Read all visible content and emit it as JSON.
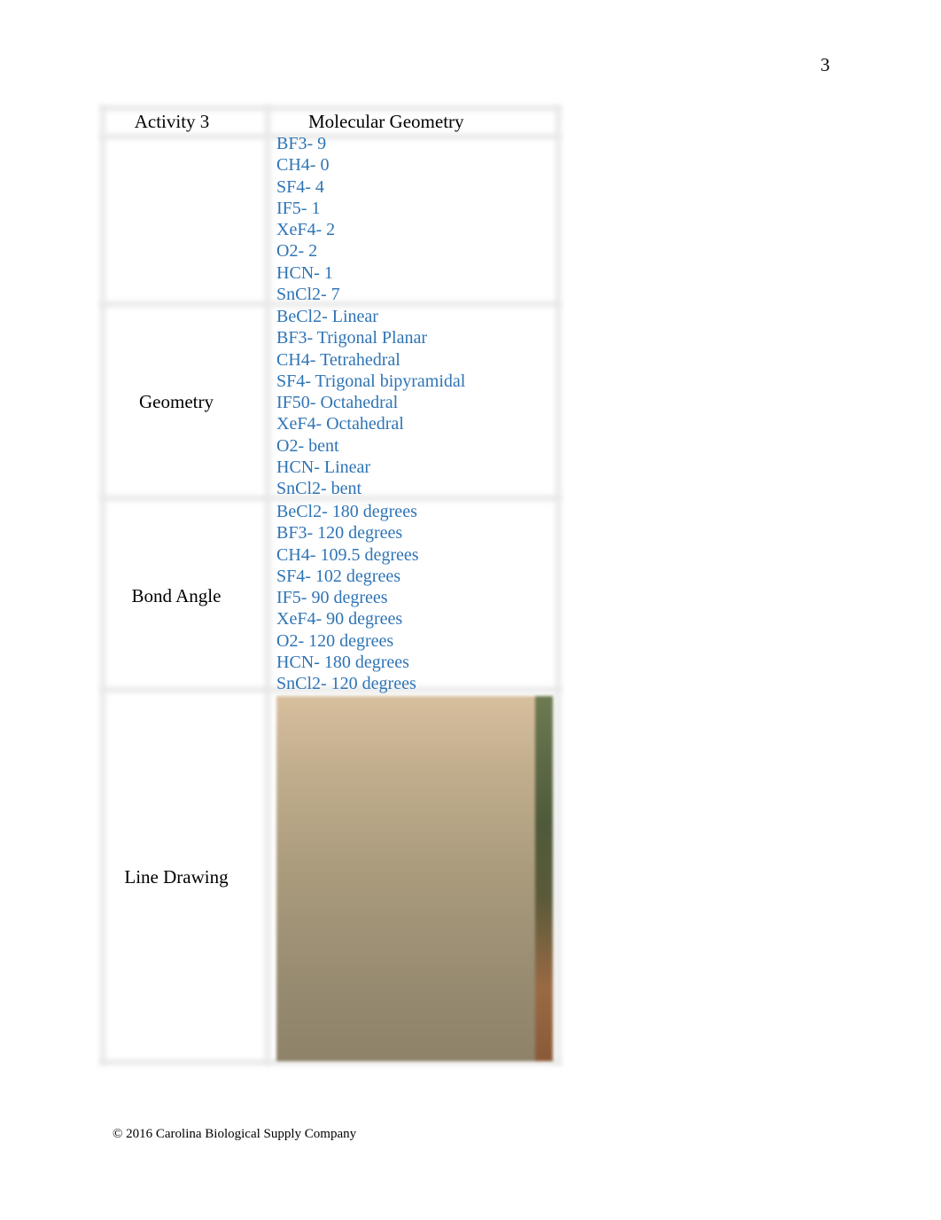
{
  "page_number": "3",
  "table": {
    "header": {
      "col1": "Activity 3",
      "col2": "Molecular Geometry"
    },
    "rows": [
      {
        "label": "",
        "entries": [
          "BF3- 9",
          "CH4- 0",
          "SF4- 4",
          "IF5- 1",
          "XeF4- 2",
          "O2- 2",
          "HCN- 1",
          "SnCl2- 7"
        ]
      },
      {
        "label": "Geometry",
        "entries": [
          "BeCl2- Linear",
          "BF3- Trigonal Planar",
          "CH4- Tetrahedral",
          "SF4- Trigonal bipyramidal",
          "IF50- Octahedral",
          "XeF4- Octahedral",
          "O2- bent",
          "HCN- Linear",
          "SnCl2- bent"
        ]
      },
      {
        "label": "Bond Angle",
        "entries": [
          "BeCl2- 180 degrees",
          "BF3- 120 degrees",
          "CH4- 109.5 degrees",
          "SF4- 102 degrees",
          "IF5- 90 degrees",
          "XeF4- 90 degrees",
          "O2- 120 degrees",
          "HCN- 180 degrees",
          "SnCl2- 120 degrees"
        ]
      },
      {
        "label": "Line Drawing",
        "image": "handwritten-line-drawings-photo"
      }
    ],
    "answer_color": "#2e74b5"
  },
  "footer": "© 2016 Carolina Biological Supply Company"
}
